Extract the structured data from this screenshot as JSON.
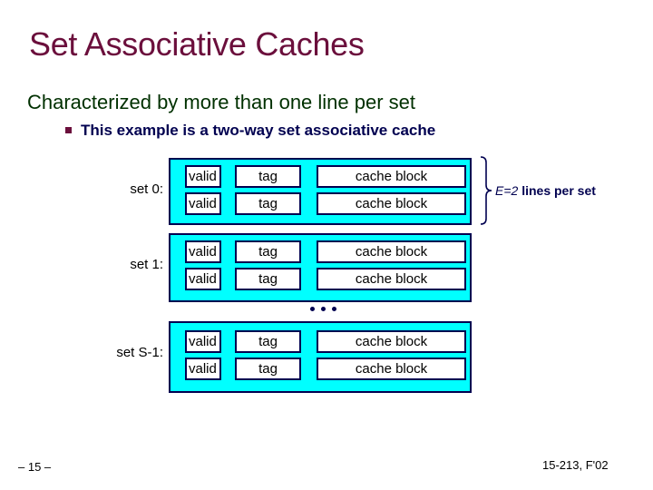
{
  "slide": {
    "title": "Set Associative Caches",
    "subtitle": "Characterized by more than one line per set",
    "bullet": "This example is a two-way set associative cache",
    "sets": [
      {
        "label": "set 0:",
        "lines": [
          {
            "valid": "valid",
            "tag": "tag",
            "block": "cache block"
          },
          {
            "valid": "valid",
            "tag": "tag",
            "block": "cache block"
          }
        ]
      },
      {
        "label": "set 1:",
        "lines": [
          {
            "valid": "valid",
            "tag": "tag",
            "block": "cache block"
          },
          {
            "valid": "valid",
            "tag": "tag",
            "block": "cache block"
          }
        ]
      },
      {
        "label": "set S-1:",
        "lines": [
          {
            "valid": "valid",
            "tag": "tag",
            "block": "cache block"
          },
          {
            "valid": "valid",
            "tag": "tag",
            "block": "cache block"
          }
        ]
      }
    ],
    "ellipsis": "•••",
    "annotation": {
      "var": "E=2",
      "text": " lines per set"
    },
    "footer": {
      "page": "– 15 –",
      "course": "15-213, F'02"
    },
    "colors": {
      "title": "#6b0f3c",
      "subtitle": "#003000",
      "bullet": "#000050",
      "set_fill": "#00ffff",
      "border": "#000050"
    }
  }
}
